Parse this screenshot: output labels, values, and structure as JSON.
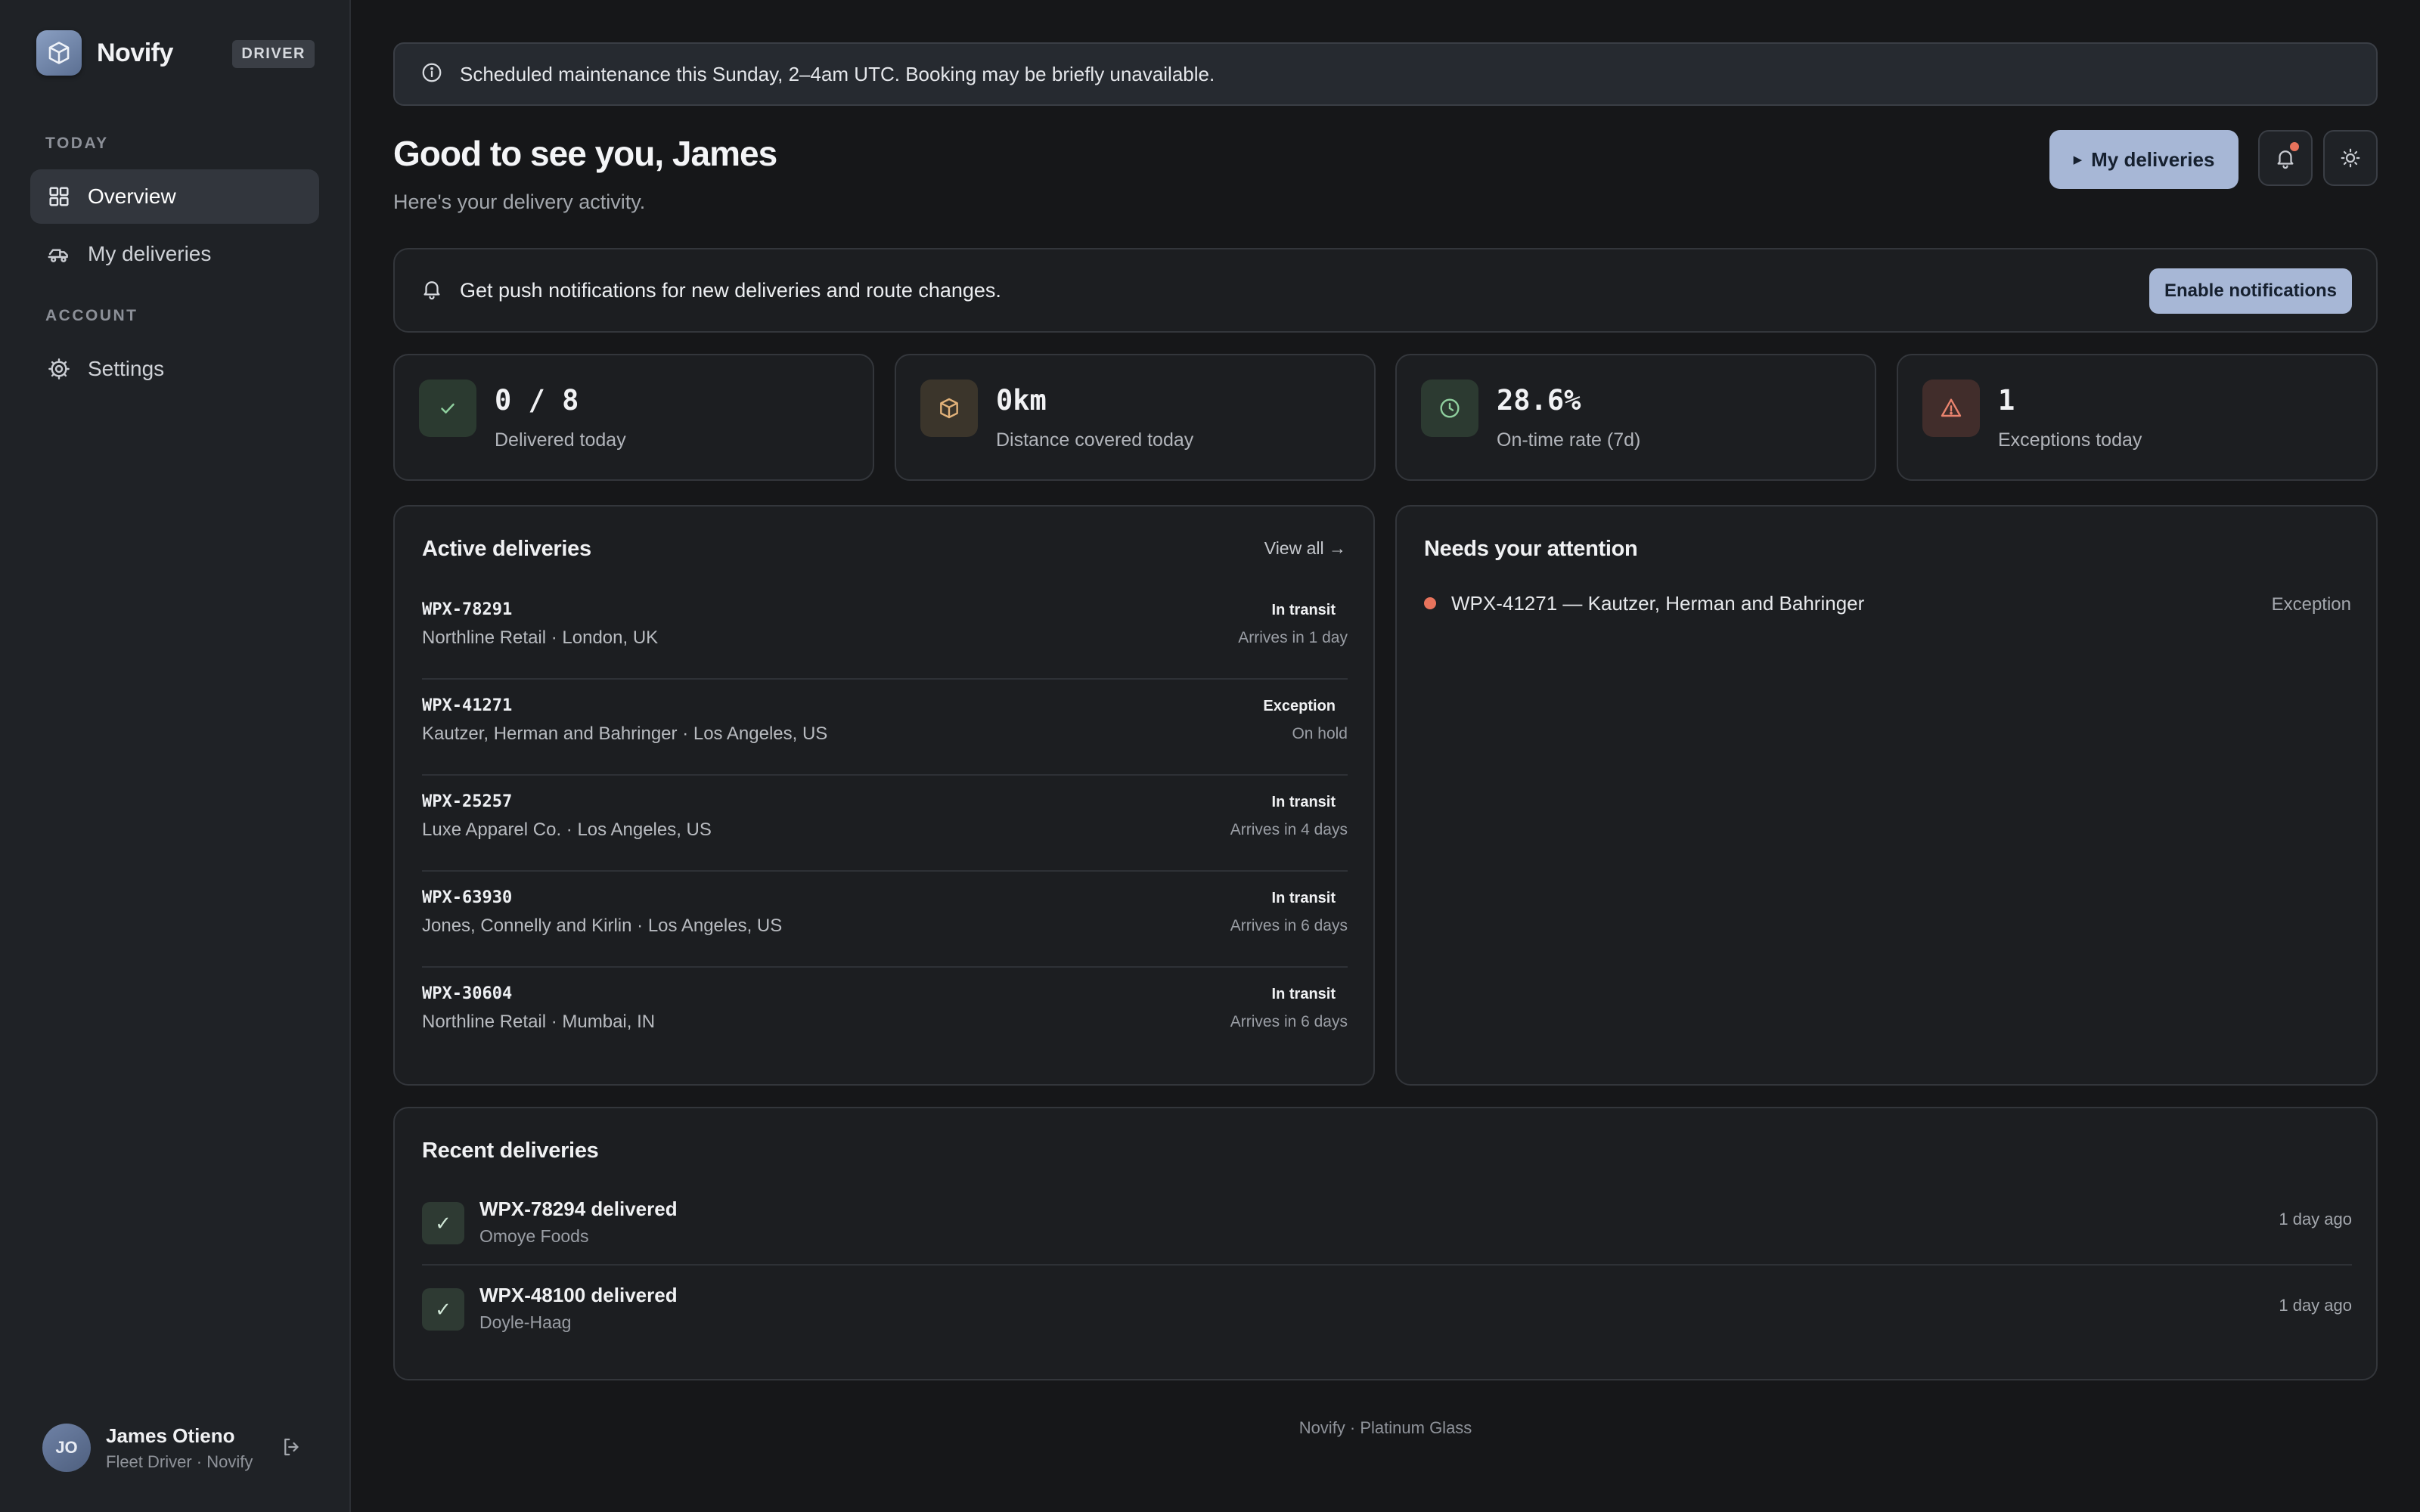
{
  "sidebar": {
    "brand_name": "Novify",
    "role_badge": "DRIVER",
    "section_today": "TODAY",
    "section_account": "ACCOUNT",
    "items": [
      {
        "label": "Overview",
        "icon": "grid-icon",
        "active": true
      },
      {
        "label": "My deliveries",
        "icon": "truck-icon",
        "active": false
      },
      {
        "label": "Settings",
        "icon": "gear-icon",
        "active": false
      }
    ],
    "user": {
      "initials": "JO",
      "name": "James Otieno",
      "subtitle": "Fleet Driver · Novify"
    }
  },
  "banner": {
    "text": "Scheduled maintenance this Sunday, 2–4am UTC. Booking may be briefly unavailable."
  },
  "header": {
    "greeting": "Good to see you, James",
    "subtitle": "Here's your delivery activity.",
    "primary_button": "My deliveries",
    "notification_indicator": true
  },
  "push": {
    "text": "Get push notifications for new deliveries and route changes.",
    "button": "Enable notifications"
  },
  "stats": [
    {
      "value": "0 / 8",
      "label": "Delivered today",
      "icon": "check-icon",
      "tint": "#2b3a30",
      "icon_color": "#8fcf9e"
    },
    {
      "value": "0km",
      "label": "Distance covered today",
      "icon": "package-icon",
      "tint": "#3b352b",
      "icon_color": "#e2b27a"
    },
    {
      "value": "28.6%",
      "label": "On-time rate (7d)",
      "icon": "clock-icon",
      "tint": "#2c3a31",
      "icon_color": "#8fcf9e"
    },
    {
      "value": "1",
      "label": "Exceptions today",
      "icon": "warning-icon",
      "tint": "#412d2b",
      "icon_color": "#e9836e"
    }
  ],
  "active": {
    "title": "Active deliveries",
    "view_all": "View all →",
    "rows": [
      {
        "id": "WPX-78291",
        "sub": "Northline Retail · London, UK",
        "status": "In transit",
        "eta": "Arrives in 1 day"
      },
      {
        "id": "WPX-41271",
        "sub": "Kautzer, Herman and Bahringer · Los Angeles, US",
        "status": "Exception",
        "eta": "On hold"
      },
      {
        "id": "WPX-25257",
        "sub": "Luxe Apparel Co. · Los Angeles, US",
        "status": "In transit",
        "eta": "Arrives in 4 days"
      },
      {
        "id": "WPX-63930",
        "sub": "Jones, Connelly and Kirlin · Los Angeles, US",
        "status": "In transit",
        "eta": "Arrives in 6 days"
      },
      {
        "id": "WPX-30604",
        "sub": "Northline Retail · Mumbai, IN",
        "status": "In transit",
        "eta": "Arrives in 6 days"
      }
    ]
  },
  "attention": {
    "title": "Needs your attention",
    "items": [
      {
        "text": "WPX-41271 — Kautzer, Herman and Bahringer",
        "tag": "Exception",
        "dot_color": "#e7735c"
      }
    ]
  },
  "recent": {
    "title": "Recent deliveries",
    "rows": [
      {
        "title": "WPX-78294 delivered",
        "sub": "Omoye Foods",
        "time": "1 day ago"
      },
      {
        "title": "WPX-48100 delivered",
        "sub": "Doyle-Haag",
        "time": "1 day ago"
      }
    ]
  },
  "footer": {
    "text": "Novify · Platinum Glass"
  },
  "colors": {
    "accent": "#a7b7d6",
    "background": "#161719",
    "sidebar": "#1f2226",
    "alert": "#e7735c"
  }
}
